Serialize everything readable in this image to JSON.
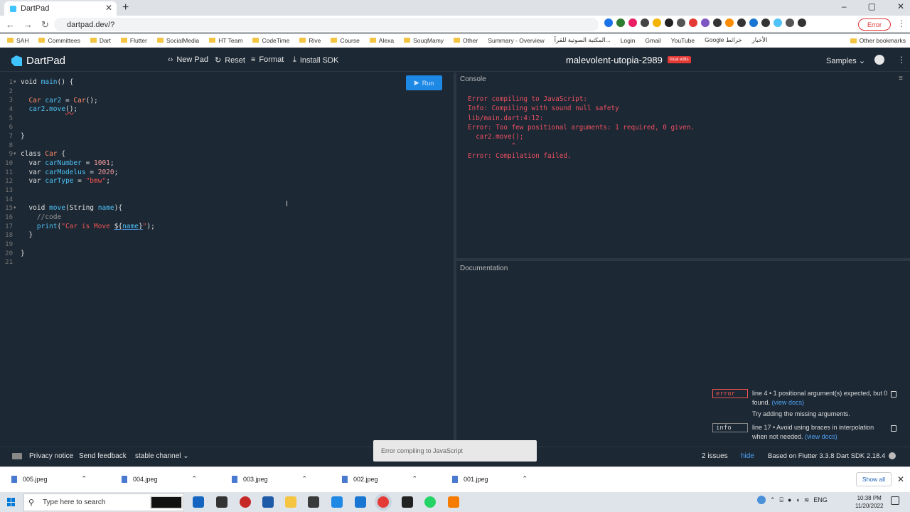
{
  "browser": {
    "tab_title": "DartPad",
    "url": "dartpad.dev/?",
    "error_pill": "Error",
    "window_controls": [
      "–",
      "▢",
      "✕"
    ],
    "bookmarks": [
      "SAH",
      "Committees",
      "Dart",
      "Flutter",
      "SocialMedia",
      "HT Team",
      "CodeTime",
      "Rive",
      "Course",
      "Alexa",
      "SouqMamy",
      "Other",
      "Summary - Overview",
      "المكتبة الصوتية للقرآ...",
      "Login",
      "Gmail",
      "YouTube",
      "Google خرائط",
      "الأخبار"
    ],
    "other_bookmarks": "Other bookmarks"
  },
  "header": {
    "logo": "DartPad",
    "new_pad": "New Pad",
    "reset": "Reset",
    "format": "Format",
    "install_sdk": "Install SDK",
    "pad_name": "malevolent-utopia-2989",
    "badge": "local edits",
    "samples": "Samples"
  },
  "editor": {
    "run": "Run",
    "line_numbers": [
      "1",
      "2",
      "3",
      "4",
      "5",
      "6",
      "7",
      "8",
      "9",
      "10",
      "11",
      "12",
      "13",
      "14",
      "15",
      "16",
      "17",
      "18",
      "19",
      "20",
      "21"
    ]
  },
  "console": {
    "label": "Console",
    "output": "Error compiling to JavaScript:\nInfo: Compiling with sound null safety\nlib/main.dart:4:12:\nError: Too few positional arguments: 1 required, 0 given.\n  car2.move();\n           ^\nError: Compilation failed."
  },
  "documentation": {
    "label": "Documentation"
  },
  "issues": [
    {
      "tag": "error",
      "text": "line 4 • 1 positional argument(s) expected, but 0 found.",
      "link": "(view docs)",
      "hint": "Try adding the missing arguments."
    },
    {
      "tag": "info",
      "text": "line 17 • Avoid using braces in interpolation when not needed.",
      "link": "(view docs)",
      "hint": ""
    }
  ],
  "footer": {
    "privacy": "Privacy notice",
    "feedback": "Send feedback",
    "channel": "stable channel",
    "issues_count": "2 issues",
    "hide": "hide",
    "sdk": "Based on Flutter 3.3.8 Dart SDK 2.18.4"
  },
  "toast": "Error compiling to JavaScript",
  "downloads": {
    "files": [
      "005.jpeg",
      "004.jpeg",
      "003.jpeg",
      "002.jpeg",
      "001.jpeg"
    ],
    "show_all": "Show all"
  },
  "taskbar": {
    "search_placeholder": "Type here to search",
    "lang": "ENG",
    "time": "10:38 PM",
    "date": "11/20/2022"
  }
}
